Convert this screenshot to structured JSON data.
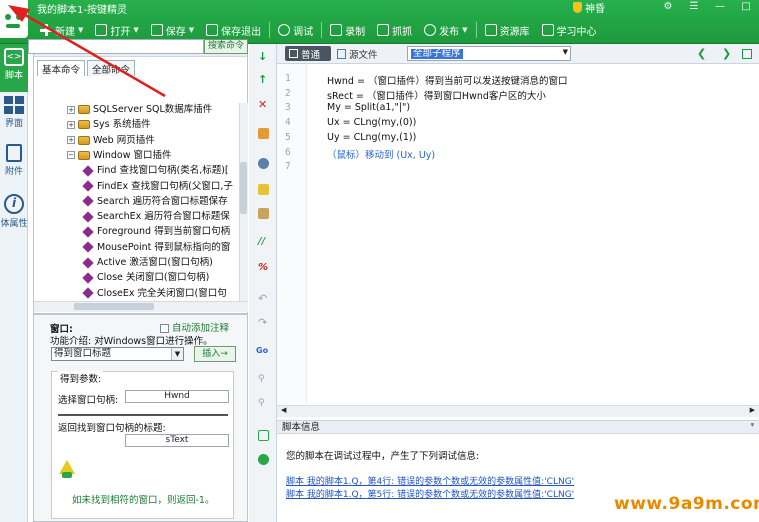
{
  "window": {
    "title": "我的脚本1-按键精灵",
    "user": "神昏",
    "controls": [
      "⚙",
      "☰",
      "—",
      "□"
    ]
  },
  "toolbar": [
    {
      "label": "新建",
      "icon": "plus-icon",
      "dropdown": true
    },
    {
      "label": "打开",
      "icon": "folder-open-icon",
      "dropdown": true
    },
    {
      "label": "保存",
      "icon": "save-icon",
      "dropdown": true
    },
    {
      "label": "保存退出",
      "icon": "save-exit-icon",
      "dropdown": false
    },
    {
      "label": "调试",
      "icon": "play-icon",
      "dropdown": false
    },
    {
      "label": "录制",
      "icon": "record-icon",
      "dropdown": false
    },
    {
      "label": "抓抓",
      "icon": "grab-icon",
      "dropdown": false
    },
    {
      "label": "发布",
      "icon": "publish-icon",
      "dropdown": true
    },
    {
      "label": "资源库",
      "icon": "resource-icon",
      "dropdown": false
    },
    {
      "label": "学习中心",
      "icon": "learn-icon",
      "dropdown": false
    }
  ],
  "left_strip": {
    "script": "脚本",
    "ui": "界面",
    "attach": "附件",
    "props": "体属性"
  },
  "command_panel": {
    "title": "全部命令",
    "pin": "📌",
    "tabs": [
      "基本命令",
      "全部命令"
    ],
    "search_button": "搜索命令",
    "tree": [
      {
        "type": "pkg",
        "label": "SQLServer SQL数据库插件",
        "indent": 1
      },
      {
        "type": "pkg",
        "label": "Sys 系统插件",
        "indent": 1
      },
      {
        "type": "pkg",
        "label": "Web 网页插件",
        "indent": 1
      },
      {
        "type": "pkg-open",
        "label": "Window 窗口插件",
        "indent": 1
      },
      {
        "type": "cmd",
        "label": "Find 查找窗口句柄(类名,标题)[",
        "indent": 2
      },
      {
        "type": "cmd",
        "label": "FindEx 查找窗口句柄(父窗口,子",
        "indent": 2
      },
      {
        "type": "cmd",
        "label": "Search 遍历符合窗口标题保存",
        "indent": 2
      },
      {
        "type": "cmd",
        "label": "SearchEx 遍历符合窗口标题保",
        "indent": 2
      },
      {
        "type": "cmd",
        "label": "Foreground 得到当前窗口句柄",
        "indent": 2
      },
      {
        "type": "cmd",
        "label": "MousePoint 得到鼠标指向的窗",
        "indent": 2
      },
      {
        "type": "cmd",
        "label": "Active 激活窗口(窗口句柄)",
        "indent": 2
      },
      {
        "type": "cmd",
        "label": "Close 关闭窗口(窗口句柄)",
        "indent": 2
      },
      {
        "type": "cmd",
        "label": "CloseEx 完全关闭窗口(窗口句",
        "indent": 2
      }
    ]
  },
  "param_panel": {
    "window_label": "窗口:",
    "auto_comment": "自动添加注释",
    "description": "功能介绍: 对Windows窗口进行操作。",
    "command_value": "得到窗口标题",
    "insert_button": "插入→",
    "params_title": "得到参数:",
    "select_handle_label": "选择窗口句柄:",
    "select_handle_value": "Hwnd",
    "return_title_label": "返回找到窗口句柄的标题:",
    "return_title_value": "sText",
    "tip": "如未找到相符的窗口，则返回-1。"
  },
  "editor": {
    "tabs": [
      "普通",
      "源文件"
    ],
    "procedure": "全部子程序",
    "lines": [
      {
        "n": "1",
        "text": "Hwnd = （窗口插件）得到当前可以发送按键消息的窗口",
        "color": "black"
      },
      {
        "n": "2",
        "text": "sRect = （窗口插件）得到窗口Hwnd客户区的大小",
        "color": "black"
      },
      {
        "n": "3",
        "text": "My = Split(a1,\"|\")",
        "color": "black"
      },
      {
        "n": "4",
        "text": "Ux = CLng(my,(0))",
        "color": "black"
      },
      {
        "n": "5",
        "text": "Uy = CLng(my,(1))",
        "color": "black"
      },
      {
        "n": "6",
        "text": "（鼠标）移动到 (Ux, Uy)",
        "color": "blue"
      },
      {
        "n": "7",
        "text": "",
        "color": "black"
      }
    ]
  },
  "info_panel": {
    "title": "脚本信息",
    "pin": "📌",
    "message": "您的脚本在调试过程中，产生了下列调试信息:",
    "errors": [
      "脚本 我的脚本1.Q，第4行: 错误的参数个数或无效的参数属性值:'CLNG'",
      "脚本 我的脚本1.Q，第5行: 错误的参数个数或无效的参数属性值:'CLNG'"
    ]
  },
  "watermark": "www.9a9m.com",
  "colors": {
    "brand_green": "#1d9a3d",
    "link_blue": "#1f55c4",
    "code_blue": "#2565d6",
    "watermark_orange": "#e88a00",
    "annotation_red": "#e02020"
  }
}
